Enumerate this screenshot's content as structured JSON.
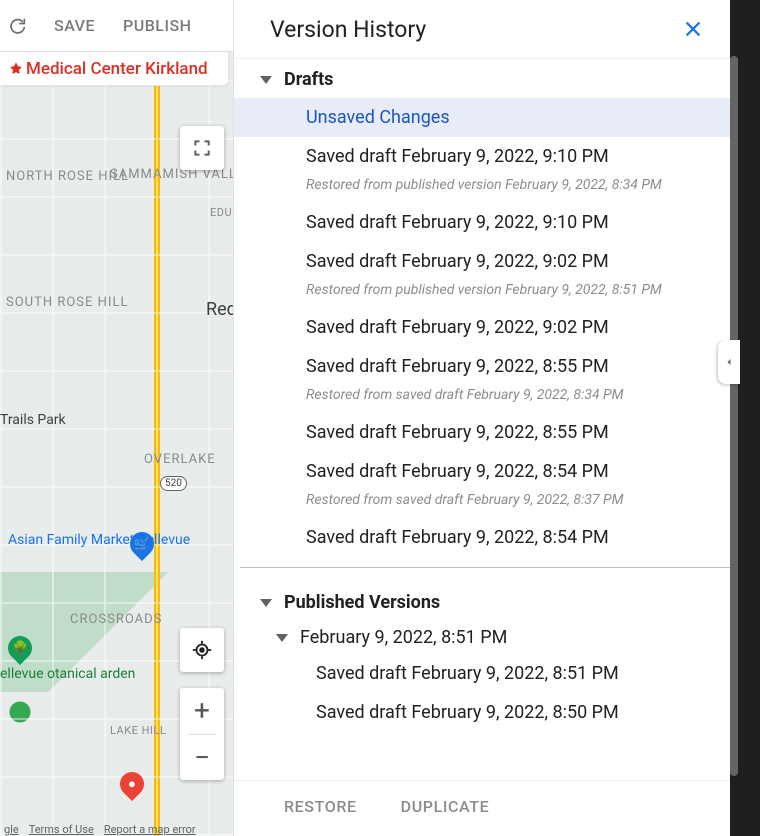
{
  "toolbar": {
    "save_label": "SAVE",
    "publish_label": "PUBLISH"
  },
  "location_pill": {
    "text": "Medical Center Kirkland"
  },
  "map": {
    "labels": {
      "north_rose_hill": "NORTH\nROSE HILL",
      "sammamish_valley": "SAMMAMISH\nVALLEY",
      "edu": "EDU",
      "south_rose_hill": "SOUTH\nROSE HILL",
      "redmond_partial": "Redn",
      "trails_park": "Trails\nPark",
      "overlake": "OVERLAKE",
      "route_520": "520",
      "asian_family_market": "Asian Family\nMarket Bellevue",
      "crossroads": "CROSSROADS",
      "bellevue_botanical": "ellevue\notanical\narden",
      "lake_hill": "LAKE HILL"
    },
    "controls": {
      "zoom_in": "+",
      "zoom_out": "−"
    },
    "footer": {
      "google_partial": "gle",
      "terms": "Terms of Use",
      "report": "Report a map error"
    }
  },
  "version_history": {
    "title": "Version History",
    "footer": {
      "restore": "RESTORE",
      "duplicate": "DUPLICATE"
    },
    "drafts": {
      "header": "Drafts",
      "items": [
        {
          "label": "Unsaved Changes",
          "selected": true
        },
        {
          "label": "Saved draft February 9, 2022, 9:10 PM",
          "note": "Restored from published version February 9, 2022, 8:34 PM"
        },
        {
          "label": "Saved draft February 9, 2022, 9:10 PM"
        },
        {
          "label": "Saved draft February 9, 2022, 9:02 PM",
          "note": "Restored from published version February 9, 2022, 8:51 PM"
        },
        {
          "label": "Saved draft February 9, 2022, 9:02 PM"
        },
        {
          "label": "Saved draft February 9, 2022, 8:55 PM",
          "note": "Restored from saved draft February 9, 2022, 8:34 PM"
        },
        {
          "label": "Saved draft February 9, 2022, 8:55 PM"
        },
        {
          "label": "Saved draft February 9, 2022, 8:54 PM",
          "note": "Restored from saved draft February 9, 2022, 8:37 PM"
        },
        {
          "label": "Saved draft February 9, 2022, 8:54 PM"
        }
      ]
    },
    "published": {
      "header": "Published Versions",
      "groups": [
        {
          "timestamp": "February 9, 2022, 8:51 PM",
          "children": [
            {
              "label": "Saved draft February 9, 2022, 8:51 PM"
            },
            {
              "label": "Saved draft February 9, 2022, 8:50 PM"
            }
          ]
        }
      ]
    }
  }
}
